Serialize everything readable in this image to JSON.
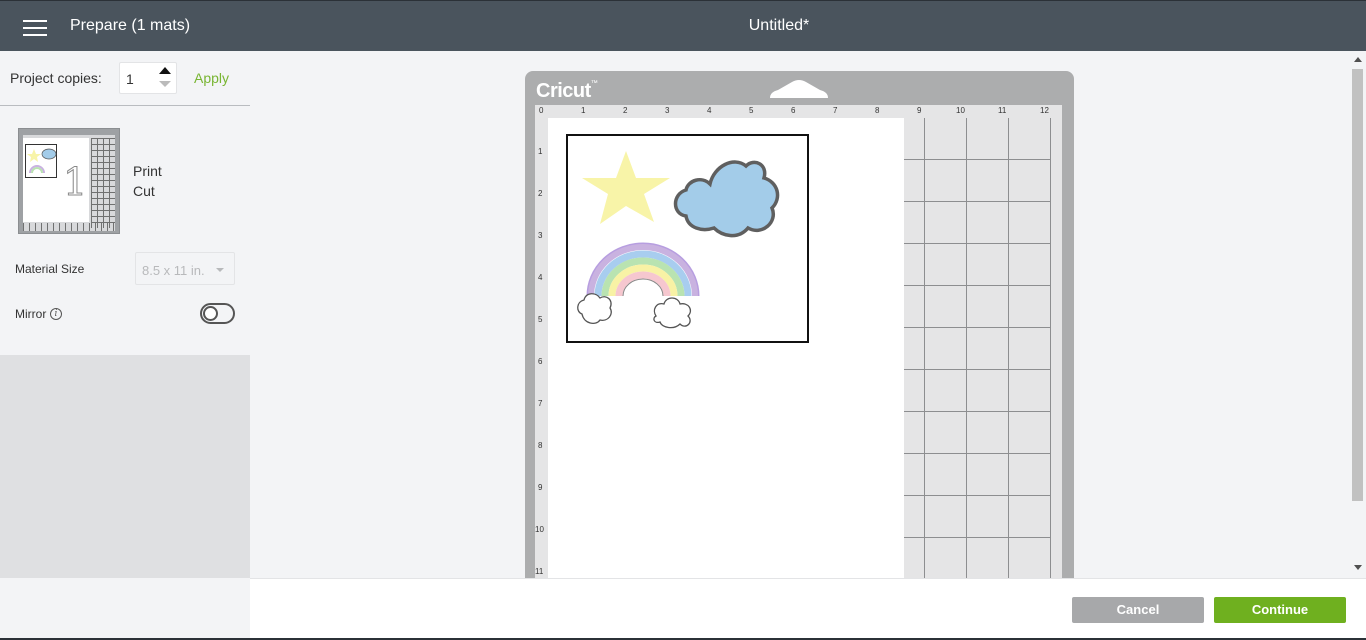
{
  "header": {
    "menu_icon": "hamburger-menu-icon",
    "prepare_title": "Prepare (1 mats)",
    "document_title": "Untitled*"
  },
  "sidebar": {
    "copies_label": "Project copies:",
    "copies_value": "1",
    "apply_label": "Apply",
    "mat_modes": [
      "Print",
      "Cut"
    ],
    "mat_thumbnail_number": "1",
    "material_size_label": "Material Size",
    "material_size_value": "8.5 x 11 in.",
    "mirror_label": "Mirror",
    "mirror_info_icon": "i",
    "mirror_enabled": false
  },
  "mat": {
    "brand": "Cricut",
    "top_ruler": [
      "0",
      "1",
      "2",
      "3",
      "4",
      "5",
      "6",
      "7",
      "8",
      "9",
      "10",
      "11",
      "12"
    ],
    "left_ruler": [
      "1",
      "2",
      "3",
      "4",
      "5",
      "6",
      "7",
      "8",
      "9",
      "10",
      "11"
    ],
    "images": [
      "star",
      "cloud",
      "rainbow"
    ],
    "colors": {
      "star": "#f8f4a8",
      "cloud": "#a3cce9",
      "rainbow_bands": [
        "#c9b2e0",
        "#a8cdef",
        "#b9e3b1",
        "#f8f2a5",
        "#f6c7cf"
      ]
    }
  },
  "footer": {
    "cancel_label": "Cancel",
    "continue_label": "Continue"
  },
  "theme": {
    "header_bg": "#4a545d",
    "accent_green": "#6fb01f",
    "apply_green": "#78b532"
  }
}
